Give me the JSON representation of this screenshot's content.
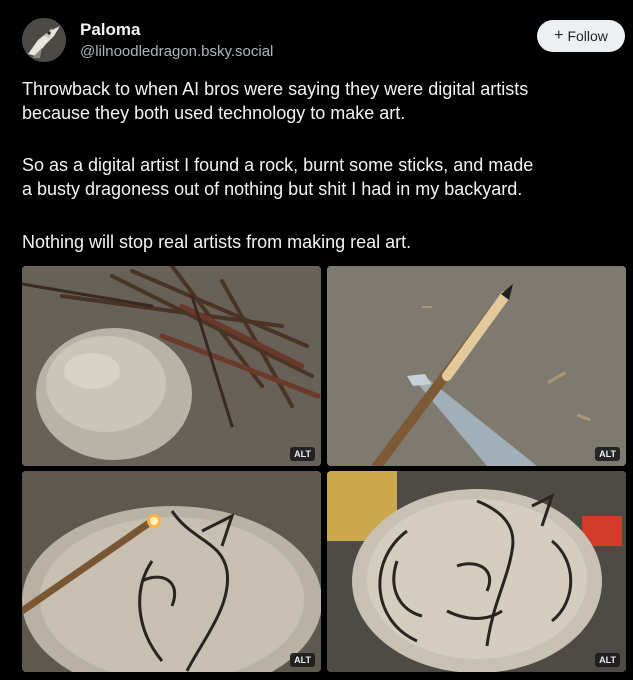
{
  "author": {
    "name": "Paloma",
    "handle": "@lilnoodledragon.bsky.social"
  },
  "follow": {
    "label": "Follow",
    "icon": "plus-icon"
  },
  "post": {
    "paragraph_1_line_1": "Throwback to when AI bros were saying they were digital artists",
    "paragraph_1_line_2": "because they both used technology to make art.",
    "paragraph_2_line_1": "So as a digital artist I found a rock, burnt some sticks, and made",
    "paragraph_2_line_2": "a busty dragoness out of nothing but shit I had in my backyard.",
    "paragraph_3": "Nothing will stop real artists from making real art."
  },
  "images": [
    {
      "alt_badge": "ALT"
    },
    {
      "alt_badge": "ALT"
    },
    {
      "alt_badge": "ALT"
    },
    {
      "alt_badge": "ALT"
    }
  ],
  "colors": {
    "background": "#000000",
    "text": "#f1f3f5",
    "muted": "#aeb4bb",
    "follow_bg": "#edf0f2"
  }
}
